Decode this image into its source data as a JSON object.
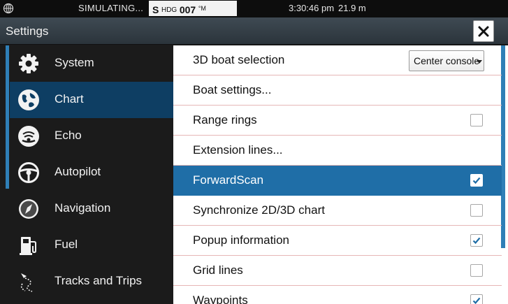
{
  "statusbar": {
    "globe_icon": "globe-icon",
    "simulating": "SIMULATING...",
    "hdg_s": "S",
    "hdg_label": "HDG",
    "hdg_value": "007",
    "hdg_unit": "°M",
    "time": "3:30:46 pm",
    "depth": "21.9 m"
  },
  "header": {
    "title": "Settings",
    "close_icon": "close-icon"
  },
  "sidebar": {
    "items": [
      {
        "label": "System",
        "icon": "gear-icon"
      },
      {
        "label": "Chart",
        "icon": "chart-icon",
        "active": true
      },
      {
        "label": "Echo",
        "icon": "echo-icon"
      },
      {
        "label": "Autopilot",
        "icon": "steering-wheel-icon"
      },
      {
        "label": "Navigation",
        "icon": "compass-icon"
      },
      {
        "label": "Fuel",
        "icon": "fuel-pump-icon"
      },
      {
        "label": "Tracks and Trips",
        "icon": "track-icon"
      }
    ]
  },
  "main": {
    "rows": [
      {
        "label": "3D boat selection",
        "control": "dropdown",
        "value": "Center console"
      },
      {
        "label": "Boat settings...",
        "control": "none"
      },
      {
        "label": "Range rings",
        "control": "checkbox",
        "checked": false
      },
      {
        "label": "Extension lines...",
        "control": "none"
      },
      {
        "label": "ForwardScan",
        "control": "checkbox",
        "checked": true,
        "highlighted": true
      },
      {
        "label": "Synchronize 2D/3D chart",
        "control": "checkbox",
        "checked": false
      },
      {
        "label": "Popup information",
        "control": "checkbox",
        "checked": true
      },
      {
        "label": "Grid lines",
        "control": "checkbox",
        "checked": false
      },
      {
        "label": "Waypoints",
        "control": "checkbox",
        "checked": true
      }
    ]
  },
  "colors": {
    "accent": "#1f6ea7",
    "sidebar_active": "#0e3e63",
    "sidebar_bg": "#1b1b1b",
    "content_bg": "#ffffff"
  }
}
